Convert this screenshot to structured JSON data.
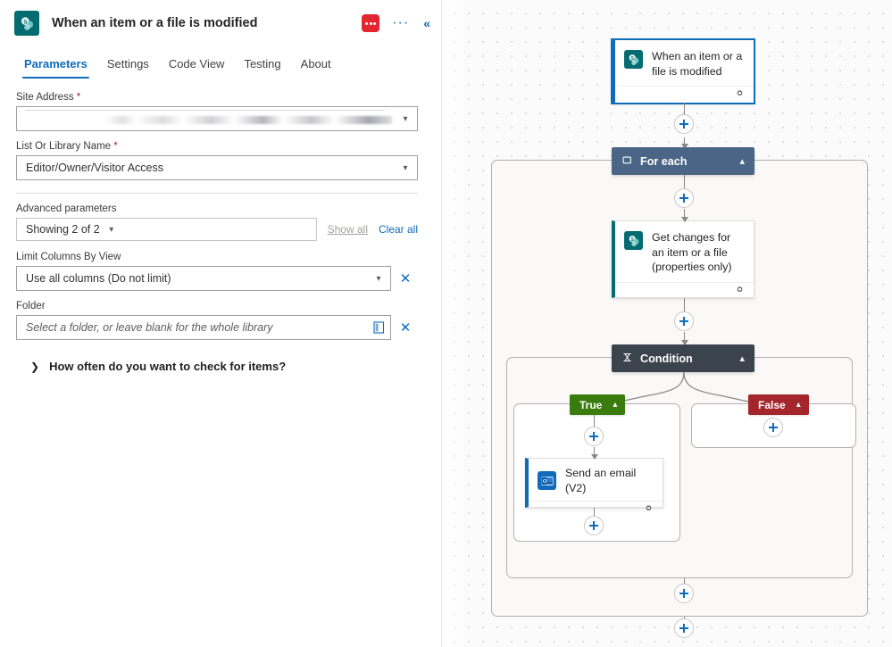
{
  "panel": {
    "app_icon": "sharepoint-icon",
    "title": "When an item or a file is modified",
    "error_badge": "error-badge",
    "more_label": "···",
    "collapse_label": "«",
    "tabs": [
      {
        "label": "Parameters",
        "active": true
      },
      {
        "label": "Settings",
        "active": false
      },
      {
        "label": "Code View",
        "active": false
      },
      {
        "label": "Testing",
        "active": false
      },
      {
        "label": "About",
        "active": false
      }
    ],
    "fields": [
      {
        "label": "Site Address",
        "required": true,
        "value": "",
        "redacted": true,
        "placeholder": "",
        "has_clear": false
      },
      {
        "label": "List Or Library Name",
        "required": true,
        "value": "Editor/Owner/Visitor Access",
        "redacted": false,
        "placeholder": "",
        "has_clear": false
      }
    ],
    "advanced": {
      "label": "Advanced parameters",
      "select_value": "Showing 2 of 2",
      "show_all_label": "Show all",
      "clear_all_label": "Clear all"
    },
    "advanced_fields": [
      {
        "label": "Limit Columns By View",
        "value": "Use all columns (Do not limit)",
        "placeholder": "",
        "kind": "dropdown",
        "clear_label": "✕"
      },
      {
        "label": "Folder",
        "value": "",
        "placeholder": "Select a folder, or leave blank for the whole library",
        "kind": "picker",
        "picker_icon": "folder-picker-icon",
        "clear_label": "✕"
      }
    ],
    "collapsed_section": {
      "chevron": "chevron-right-icon",
      "label": "How often do you want to check for items?"
    }
  },
  "canvas": {
    "nodes": [
      {
        "id": "trigger",
        "name": "trigger-node",
        "title": "When an item or a file is modified",
        "icon": "sharepoint-icon",
        "accent": "#0f6cbd",
        "selected": true,
        "footer_icon": "connection-reference-icon"
      },
      {
        "id": "foreach",
        "name": "for-each-node",
        "title": "For each",
        "icon": "loop-icon",
        "header_color": "#4a6585",
        "chevron": "chevron-up-icon"
      },
      {
        "id": "getchanges",
        "name": "get-changes-node",
        "title": "Get changes for an item or a file (properties only)",
        "icon": "sharepoint-icon",
        "accent": "#036C70",
        "selected": false,
        "footer_icon": "connection-reference-icon"
      },
      {
        "id": "condition",
        "name": "condition-node",
        "title": "Condition",
        "icon": "condition-icon",
        "header_color": "#3b444d",
        "chevron": "chevron-up-icon"
      },
      {
        "id": "sendemail",
        "name": "send-email-node",
        "title": "Send an email (V2)",
        "icon": "outlook-icon",
        "accent": "#0f6cbd",
        "selected": false,
        "footer_icon": "connection-reference-icon"
      }
    ],
    "branches": [
      {
        "id": "true",
        "label": "True",
        "color": "#3a7d0e",
        "chevron": "chevron-up-icon"
      },
      {
        "id": "false",
        "label": "False",
        "color": "#a4262c",
        "chevron": "chevron-up-icon"
      }
    ],
    "add_buttons": [
      "add-step-after-trigger",
      "add-step-in-foreach-top",
      "add-step-after-getchanges",
      "add-step-true-branch-top",
      "add-step-false-branch",
      "add-step-true-branch-bottom",
      "add-step-after-condition",
      "add-step-after-foreach"
    ]
  }
}
